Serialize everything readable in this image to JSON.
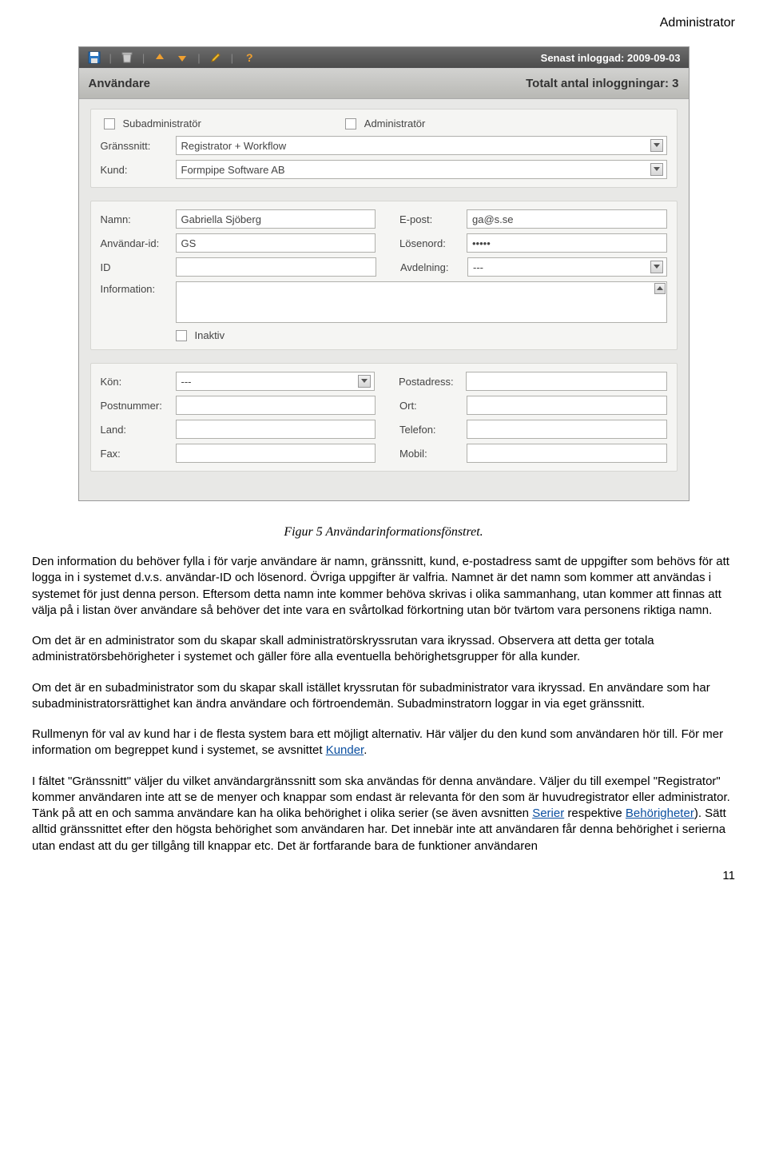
{
  "header": {
    "label": "Administrator"
  },
  "toolbar": {
    "status": "Senast inloggad: 2009-09-03"
  },
  "titlebar": {
    "left": "Användare",
    "right": "Totalt antal inloggningar: 3"
  },
  "section1": {
    "subadmin_label": "Subadministratör",
    "admin_label": "Administratör",
    "granssnitt_label": "Gränssnitt:",
    "granssnitt_value": "Registrator + Workflow",
    "kund_label": "Kund:",
    "kund_value": "Formpipe Software AB"
  },
  "section2": {
    "namn_label": "Namn:",
    "namn_value": "Gabriella Sjöberg",
    "epost_label": "E-post:",
    "epost_value": "ga@s.se",
    "anvid_label": "Användar-id:",
    "anvid_value": "GS",
    "losenord_label": "Lösenord:",
    "losenord_value": "•••••",
    "id_label": "ID",
    "id_value": "",
    "avdelning_label": "Avdelning:",
    "avdelning_value": "---",
    "info_label": "Information:",
    "inaktiv_label": "Inaktiv"
  },
  "section3": {
    "kon_label": "Kön:",
    "kon_value": "---",
    "postadress_label": "Postadress:",
    "postadress_value": "",
    "postnummer_label": "Postnummer:",
    "postnummer_value": "",
    "ort_label": "Ort:",
    "ort_value": "",
    "land_label": "Land:",
    "land_value": "",
    "telefon_label": "Telefon:",
    "telefon_value": "",
    "fax_label": "Fax:",
    "fax_value": "",
    "mobil_label": "Mobil:",
    "mobil_value": ""
  },
  "caption": "Figur 5 Användarinformationsfönstret.",
  "paragraphs": {
    "p1a": "Den information du behöver fylla i för varje användare är namn, gränssnitt, kund, e-postadress samt de uppgifter som behövs för att logga in i systemet d.v.s. användar-ID och lösenord. Övriga uppgifter är valfria. Namnet är det namn som kommer att användas i systemet för just denna person. Eftersom detta namn inte kommer behöva skrivas i olika sammanhang, utan kommer att finnas att välja på i listan över användare så behöver det inte vara en svårtolkad förkortning utan bör tvärtom vara personens riktiga namn.",
    "p2": "Om det är en administrator som du skapar skall administratörskryssrutan vara ikryssad. Observera att detta ger totala administratörsbehörigheter i systemet och gäller före alla eventuella behörighetsgrupper för alla kunder.",
    "p3": "Om det är en subadministrator som du skapar skall istället kryssrutan för subadministrator vara ikryssad. En användare som har subadministratorsrättighet kan ändra användare och förtroendemän. Subadminstratorn loggar in via eget gränssnitt.",
    "p4a": "Rullmenyn för val av kund har i de flesta system bara ett möjligt alternativ. Här väljer du den kund som användaren hör till. För mer information om begreppet kund i systemet, se avsnittet ",
    "p4link": "Kunder",
    "p4b": ".",
    "p5a": "I fältet \"Gränssnitt\" väljer du vilket användargränssnitt som ska användas för denna användare. Väljer du till exempel \"Registrator\" kommer användaren inte att se de menyer och knappar som endast är relevanta för den som är huvudregistrator eller administrator. Tänk på att en och samma användare kan ha olika behörighet i olika serier (se även avsnitten ",
    "p5link1": "Serier",
    "p5mid": " respektive ",
    "p5link2": "Behörigheter",
    "p5b": "). Sätt alltid gränssnittet efter den högsta behörighet som användaren har. Det innebär inte att användaren får denna behörighet i serierna utan endast att du ger tillgång till knappar etc. Det är fortfarande bara de funktioner användaren"
  },
  "page_number": "11"
}
